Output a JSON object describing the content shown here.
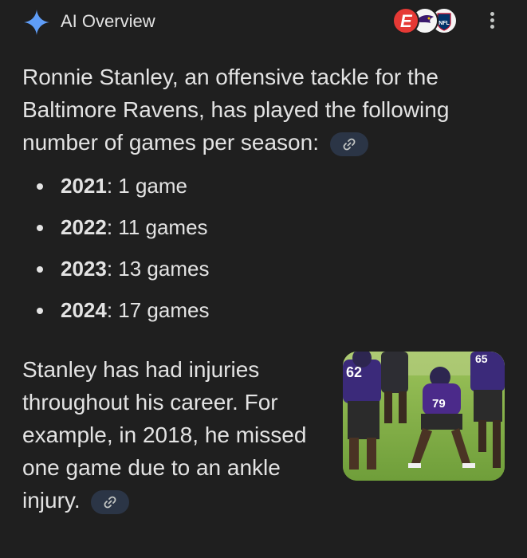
{
  "header": {
    "title": "AI Overview",
    "sources": [
      {
        "name": "espn-source",
        "letter": "E",
        "color": "#e53935"
      },
      {
        "name": "ravens-source",
        "color": "#3b1a6e"
      },
      {
        "name": "nfl-source",
        "label": "NFL",
        "color": "#013369"
      }
    ],
    "accent": "#4f8ff7"
  },
  "intro": {
    "text": "Ronnie Stanley, an offensive tackle for the Baltimore Ravens, has played the following number of games per season:"
  },
  "seasons": [
    {
      "year": "2021",
      "games": ": 1 game"
    },
    {
      "year": "2022",
      "games": ": 11 games"
    },
    {
      "year": "2023",
      "games": ": 13 games"
    },
    {
      "year": "2024",
      "games": ": 17 games"
    }
  ],
  "injury": {
    "text": "Stanley has had injuries throughout his career. For example, in 2018, he missed one game due to an ankle injury."
  },
  "photo": {
    "jersey_numbers": [
      "62",
      "79",
      "65"
    ]
  },
  "colors": {
    "background": "#1f1f1f",
    "text": "#e3e3e3",
    "chip": "#2b3546",
    "ravens_purple": "#4b2a8a",
    "field": "#7fae43"
  }
}
